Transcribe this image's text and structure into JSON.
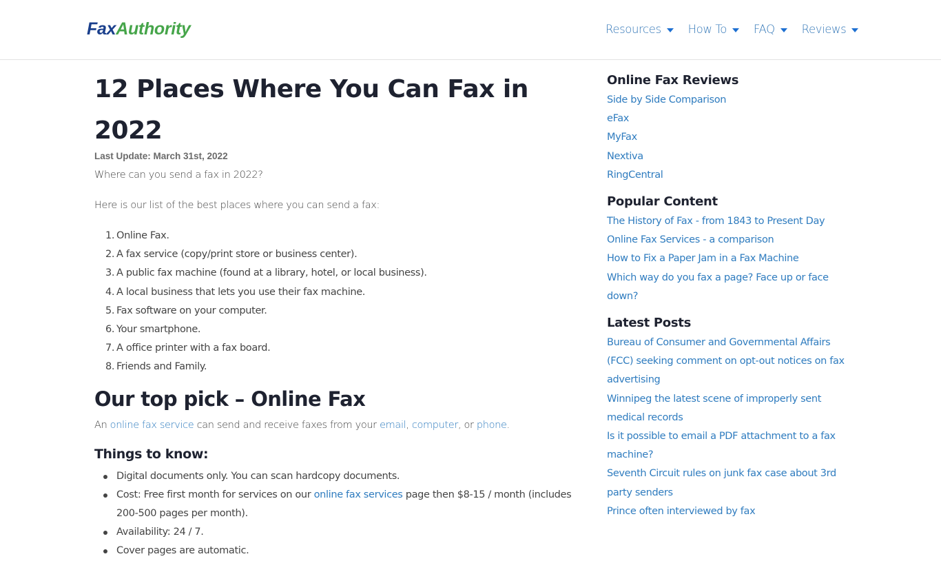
{
  "header": {
    "logo": {
      "part1": "Fax",
      "part2": "Authority"
    },
    "nav": [
      {
        "label": "Resources"
      },
      {
        "label": "How To"
      },
      {
        "label": "FAQ"
      },
      {
        "label": "Reviews"
      }
    ]
  },
  "article": {
    "title": "12 Places Where You Can Fax in 2022",
    "last_update": "Last Update: March 31st, 2022",
    "intro": "Where can you send a fax in 2022?",
    "list_intro": "Here is our list of the best places where you can send a fax:",
    "places": [
      {
        "num": "1.",
        "text": "Online Fax."
      },
      {
        "num": "2.",
        "text": "A fax service (copy/print store or business center)."
      },
      {
        "num": "3.",
        "text": "A public fax machine (found at a library, hotel, or local business)."
      },
      {
        "num": "4.",
        "text": "A local business that lets you use their fax machine."
      },
      {
        "num": "5.",
        "text": "Fax software on your computer."
      },
      {
        "num": "6.",
        "text": "Your smartphone."
      },
      {
        "num": "7.",
        "text": "A office printer with a fax board."
      },
      {
        "num": "8.",
        "text": "Friends and Family."
      }
    ],
    "top_pick_heading": "Our top pick – Online Fax",
    "top_pick_para": {
      "t1": "An ",
      "link1": "online fax service",
      "t2": " can send and receive faxes from your ",
      "link2": "email",
      "t3": ", ",
      "link3": "computer",
      "t4": ", or ",
      "link4": "phone",
      "t5": "."
    },
    "things_heading": "Things to know:",
    "things": {
      "item1": "Digital documents only. You can scan hardcopy documents.",
      "item2_pre": "Cost: Free first month for services on our ",
      "item2_link": "online fax services",
      "item2_post": " page then $8-15 / month (includes 200-500 pages per month).",
      "item3": "Availability: 24 / 7.",
      "item4": "Cover pages are automatic."
    }
  },
  "sidebar": {
    "reviews": {
      "heading": "Online Fax Reviews",
      "links": [
        "Side by Side Comparison",
        "eFax",
        "MyFax",
        "Nextiva",
        "RingCentral"
      ]
    },
    "popular": {
      "heading": "Popular Content",
      "links": [
        "The History of Fax - from 1843 to Present Day",
        "Online Fax Services - a comparison",
        "How to Fix a Paper Jam in a Fax Machine",
        "Which way do you fax a page? Face up or face down?"
      ]
    },
    "latest": {
      "heading": "Latest Posts",
      "links": [
        "Bureau of Consumer and Governmental Affairs (FCC) seeking comment on opt-out notices on fax advertising",
        "Winnipeg the latest scene of improperly sent medical records",
        "Is it possible to email a PDF attachment to a fax machine?",
        "Seventh Circuit rules on junk fax case about 3rd party senders",
        "Prince often interviewed by fax"
      ]
    }
  },
  "colors": {
    "logo_fax": "#1a3f8c",
    "logo_authority": "#46a54a",
    "link": "#2f7cbf",
    "heading": "#1e2230"
  }
}
